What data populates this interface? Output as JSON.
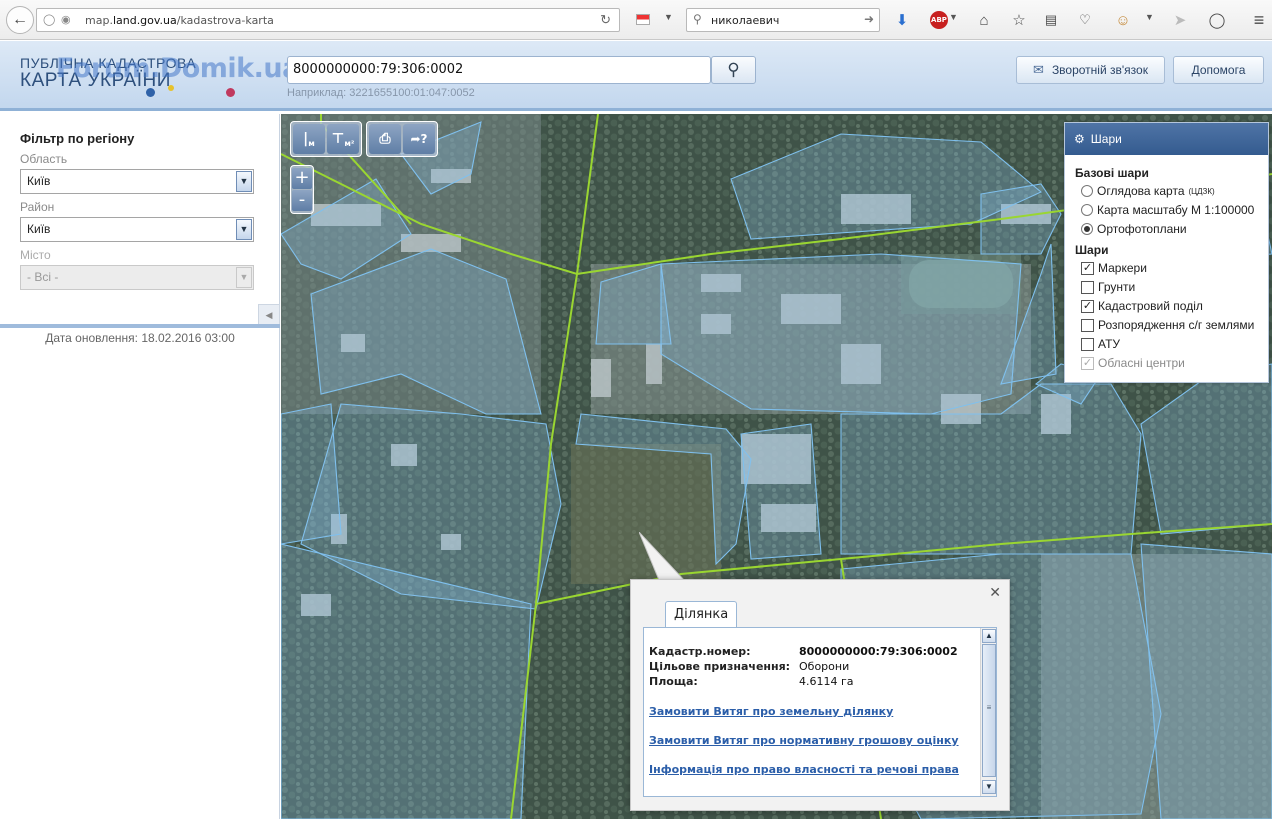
{
  "browser": {
    "url_prefix": "map.",
    "url_domain": "land.gov.ua",
    "url_path": "/kadastrova-karta",
    "search_value": "николаевич"
  },
  "header": {
    "logo_line1": "ПУБЛІЧНА КАДАСТРОВА",
    "logo_line2": "КАРТА УКРАЇНИ",
    "watermark": "Forum.Domik.ua",
    "search_value": "8000000000:79:306:0002",
    "example": "Наприклад: 3221655100:01:047:0052",
    "feedback_label": "Зворотній зв'язок",
    "help_label": "Допомога"
  },
  "filter": {
    "title": "Фільтр по регіону",
    "oblast_label": "Область",
    "oblast_value": "Київ",
    "raion_label": "Район",
    "raion_value": "Київ",
    "misto_label": "Місто",
    "misto_value": "- Всі -",
    "update_date": "Дата оновлення: 18.02.2016 03:00"
  },
  "map_tools": {
    "measure_length": "м",
    "measure_area": "м²"
  },
  "zoom": {
    "in": "+",
    "out": "-"
  },
  "layers": {
    "title": "Шари",
    "base_title": "Базові шари",
    "base": [
      {
        "label": "Оглядова карта",
        "sup": "(ЦДЗК)",
        "selected": false
      },
      {
        "label": "Карта масштабу М 1:100000",
        "sup": "",
        "selected": false
      },
      {
        "label": "Ортофотоплани",
        "sup": "",
        "selected": true
      }
    ],
    "overlay_title": "Шари",
    "overlays": [
      {
        "label": "Маркери",
        "checked": true,
        "disabled": false
      },
      {
        "label": "Грунти",
        "checked": false,
        "disabled": false
      },
      {
        "label": "Кадастровий поділ",
        "checked": true,
        "disabled": false
      },
      {
        "label": "Розпорядження с/г землями",
        "checked": false,
        "disabled": false
      },
      {
        "label": "АТУ",
        "checked": false,
        "disabled": false
      },
      {
        "label": "Обласні центри",
        "checked": true,
        "disabled": true
      }
    ]
  },
  "popup": {
    "tab": "Ділянка",
    "cadastre_key": "Кадастр.номер:",
    "cadastre_val": "8000000000:79:306:0002",
    "purpose_key": "Цільове призначення:",
    "purpose_val": "Оборони",
    "area_key": "Площа:",
    "area_val": "4.6114 га",
    "link1": "Замовити Витяг про земельну ділянку",
    "link2": "Замовити Витяг про нормативну грошову оцінку",
    "link3": "Інформація про право власності та речові права"
  }
}
